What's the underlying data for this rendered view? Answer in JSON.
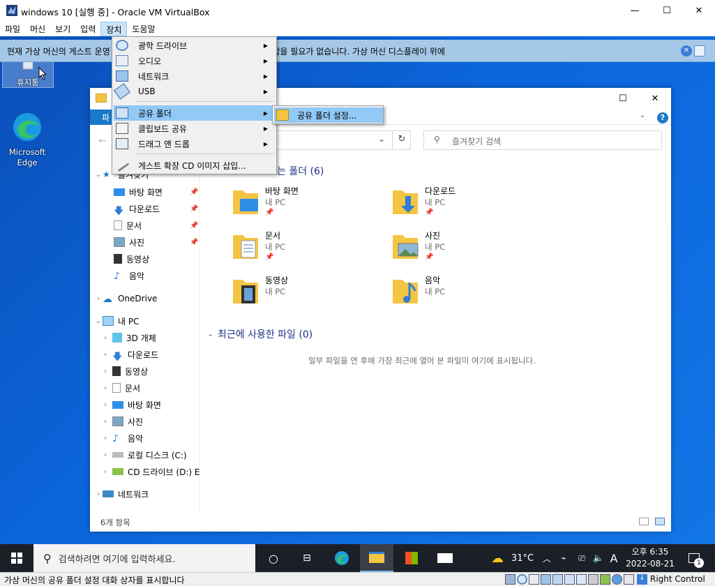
{
  "vbox": {
    "title": "windows 10 [실행 중] - Oracle VM VirtualBox",
    "menu": [
      "파일",
      "머신",
      "보기",
      "입력",
      "장치",
      "도움말"
    ],
    "notification": "현재 가상 머신의 게스트 운영 체제에서 마우스를 사용하기 위해서 포인터를 잡을 필요가 없습니다. 가상 머신 디스플레이 위에",
    "status_text": "가상 머신의 공유 폴더 설정 대화 상자를 표시합니다",
    "host_key": "Right Control"
  },
  "device_menu": {
    "items": [
      {
        "label": "광학 드라이브",
        "icon": "optical-drive-icon",
        "submenu": true
      },
      {
        "label": "오디오",
        "icon": "audio-icon",
        "submenu": true
      },
      {
        "label": "네트워크",
        "icon": "network-icon",
        "submenu": true
      },
      {
        "label": "USB",
        "icon": "usb-icon",
        "submenu": true
      },
      {
        "label": "공유 폴더",
        "icon": "shared-folder-icon",
        "submenu": true,
        "highlighted": true
      },
      {
        "label": "클립보드 공유",
        "icon": "clipboard-icon",
        "submenu": true
      },
      {
        "label": "드래그 앤 드롭",
        "icon": "drag-drop-icon",
        "submenu": true
      },
      {
        "label": "게스트 확장 CD 이미지 삽입...",
        "icon": "cd-insert-icon",
        "submenu": false
      }
    ],
    "submenu_item": "공유 폴더 설정..."
  },
  "desktop": {
    "recycle_bin": "휴지통",
    "edge": "Microsoft Edge"
  },
  "explorer": {
    "ribbon_file": "파일",
    "search_placeholder": "즐겨찾기 검색",
    "quick_access_header": "자주 사용하는 폴더 (6)",
    "quick_access_header_visible": "는 폴더 (6)",
    "recent_header": "최근에 사용한 파일 (0)",
    "recent_empty": "일부 파일을 연 후에 가장 최근에 열어 본 파일이 여기에 표시됩니다.",
    "item_count": "6개 항목",
    "folders": [
      {
        "name": "바탕 화면",
        "sub": "내 PC"
      },
      {
        "name": "다운로드",
        "sub": "내 PC"
      },
      {
        "name": "문서",
        "sub": "내 PC"
      },
      {
        "name": "사진",
        "sub": "내 PC"
      },
      {
        "name": "동영상",
        "sub": "내 PC"
      },
      {
        "name": "음악",
        "sub": "내 PC"
      }
    ],
    "nav": {
      "quick_access": "즐겨찾기",
      "quick": [
        "바탕 화면",
        "다운로드",
        "문서",
        "사진",
        "동영상",
        "음악"
      ],
      "onedrive": "OneDrive",
      "thispc": "내 PC",
      "pc": [
        "3D 개체",
        "다운로드",
        "동영상",
        "문서",
        "바탕 화면",
        "사진",
        "음악",
        "로컬 디스크 (C:)",
        "CD 드라이브 (D:) E"
      ],
      "network": "네트워크"
    }
  },
  "taskbar": {
    "search_placeholder": "검색하려면 여기에 입력하세요.",
    "weather": "31°C",
    "ime": "A",
    "time": "오후 6:35",
    "date": "2022-08-21",
    "notif_count": "1"
  },
  "colors": {
    "desktop": "#0b66dc",
    "menu_highlight": "#91c9f7",
    "taskbar": "#1b1f27",
    "explorer_accent": "#1979ca"
  }
}
